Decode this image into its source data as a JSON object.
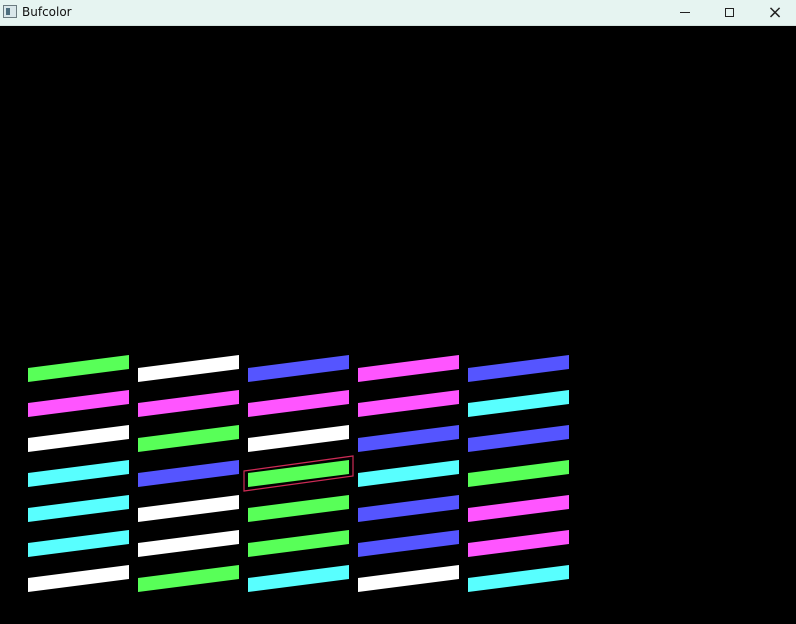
{
  "window": {
    "title": "Bufcolor",
    "controls": [
      "minimize",
      "maximize",
      "close"
    ]
  },
  "colors": {
    "green": "#58ff58",
    "magenta": "#ff55ff",
    "white": "#ffffff",
    "cyan": "#58ffff",
    "blue": "#5555ff",
    "selection": "#cc2b55",
    "background": "#000000"
  },
  "board": {
    "columns": [
      [
        "green",
        "magenta",
        "white",
        "cyan",
        "cyan",
        "cyan",
        "white"
      ],
      [
        "white",
        "magenta",
        "green",
        "blue",
        "white",
        "white",
        "green"
      ],
      [
        "blue",
        "magenta",
        "white",
        "green",
        "green",
        "green",
        "cyan"
      ],
      [
        "magenta",
        "magenta",
        "blue",
        "cyan",
        "blue",
        "blue",
        "white"
      ],
      [
        "blue",
        "cyan",
        "blue",
        "green",
        "magenta",
        "magenta",
        "cyan"
      ]
    ],
    "selected": {
      "column": 3,
      "row": 4
    }
  }
}
